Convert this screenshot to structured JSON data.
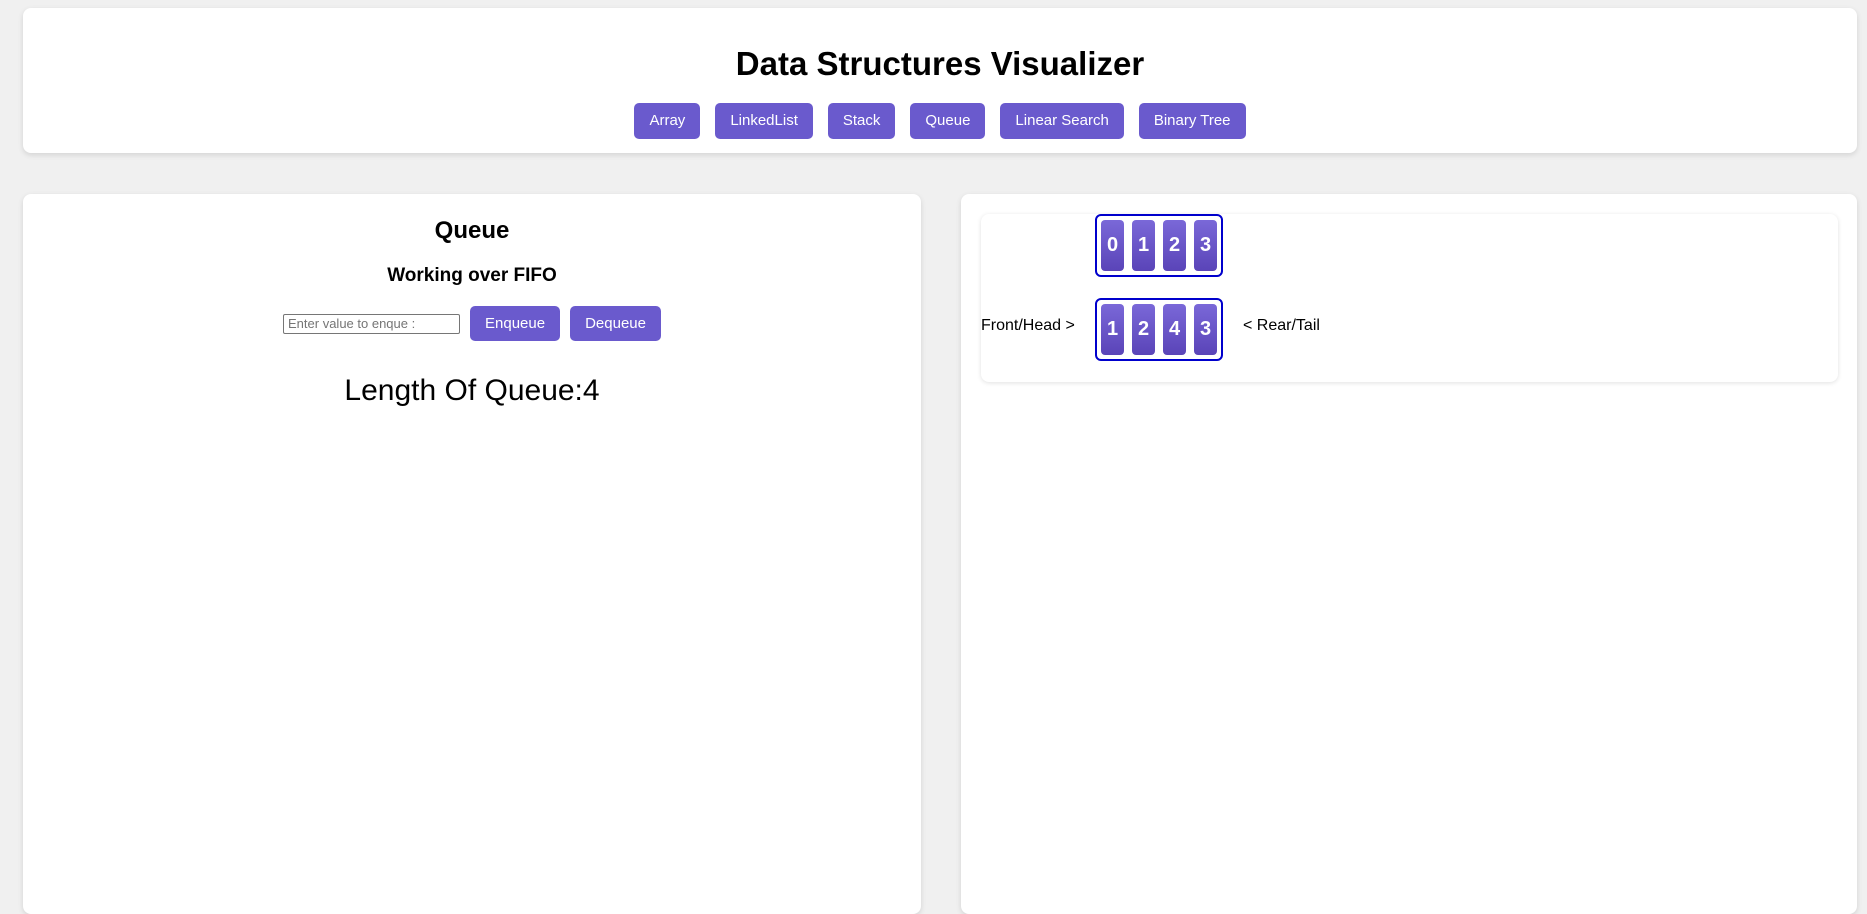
{
  "header": {
    "title": "Data Structures Visualizer",
    "nav": [
      {
        "label": "Array"
      },
      {
        "label": "LinkedList"
      },
      {
        "label": "Stack"
      },
      {
        "label": "Queue"
      },
      {
        "label": "Linear Search"
      },
      {
        "label": "Binary Tree"
      }
    ]
  },
  "queue_panel": {
    "title": "Queue",
    "subtitle": "Working over FIFO",
    "input_placeholder": "Enter value to enque :",
    "input_value": "",
    "enqueue_label": "Enqueue",
    "dequeue_label": "Dequeue",
    "length_text": "Length Of Queue:4"
  },
  "visualization": {
    "indices": [
      "0",
      "1",
      "2",
      "3"
    ],
    "values": [
      "1",
      "2",
      "4",
      "3"
    ],
    "front_label": "Front/Head >",
    "rear_label": "< Rear/Tail"
  },
  "colors": {
    "accent": "#6a5acd",
    "cell_top": "#7a68d8",
    "cell_bottom": "#5a44b8",
    "group_border": "#0000cc",
    "background": "#f0f0f0"
  }
}
